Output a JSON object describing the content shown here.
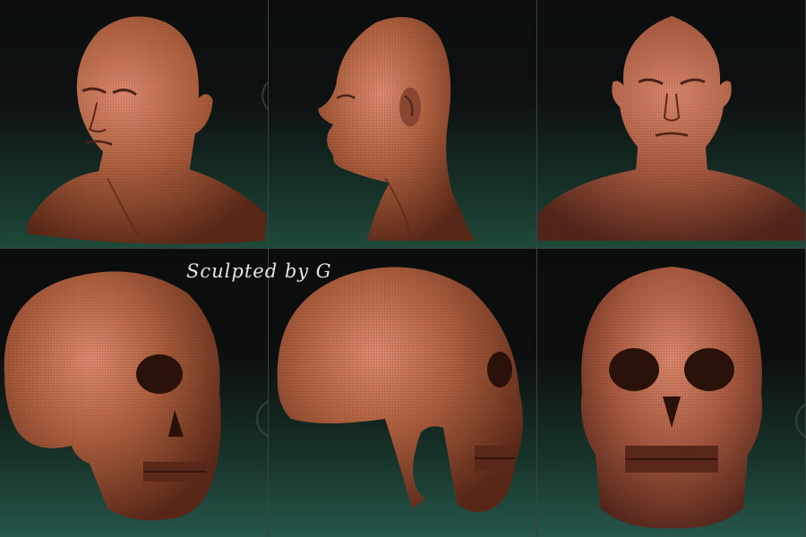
{
  "signature": {
    "text": "Sculpted by G"
  },
  "views": [
    {
      "id": "head-three-quarter",
      "subject": "head",
      "angle": "three-quarter"
    },
    {
      "id": "head-profile",
      "subject": "head",
      "angle": "profile"
    },
    {
      "id": "head-front",
      "subject": "head",
      "angle": "front"
    },
    {
      "id": "skull-three-quarter",
      "subject": "skull",
      "angle": "three-quarter"
    },
    {
      "id": "skull-profile",
      "subject": "skull",
      "angle": "profile"
    },
    {
      "id": "skull-front",
      "subject": "skull",
      "angle": "front"
    }
  ],
  "colors": {
    "sculpt_base": "#a8593f",
    "sculpt_highlight": "#d9876a",
    "sculpt_shadow": "#4a2216",
    "background_dark": "#0c0e0e",
    "background_floor": "#1f4a3a",
    "divider": "#3a4242",
    "signature": "#e4e4e4"
  }
}
